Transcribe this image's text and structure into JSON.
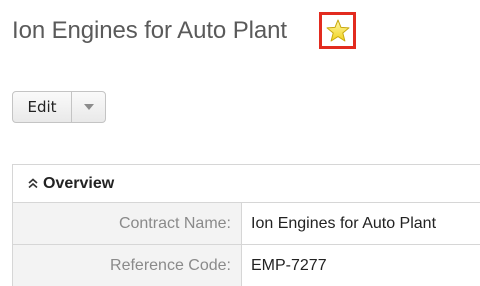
{
  "record": {
    "title": "Ion Engines for Auto Plant",
    "favorite_icon": "star-icon",
    "favorite_color": "#f5e12e"
  },
  "actions": {
    "edit_label": "Edit",
    "dropdown_icon": "caret-down-icon"
  },
  "panel": {
    "header": "Overview",
    "toggle_icon": "double-chevron-up-icon",
    "fields": [
      {
        "label": "Contract Name:",
        "value": "Ion Engines for Auto Plant"
      },
      {
        "label": "Reference Code:",
        "value": "EMP-7277"
      }
    ]
  },
  "colors": {
    "highlight_border": "#e22b1f"
  }
}
